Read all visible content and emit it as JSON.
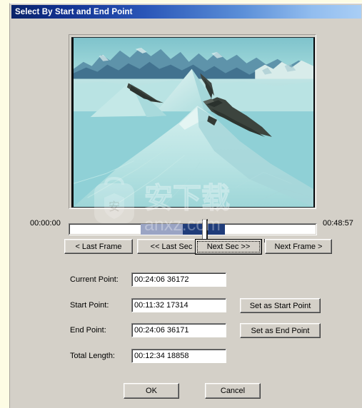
{
  "window": {
    "title": "Select By Start and End Point"
  },
  "preview": {
    "name": "video-preview",
    "description": "Snowy glacial mountain landscape video frame"
  },
  "timeline": {
    "start_label": "00:00:00",
    "end_label": "00:48:57",
    "tick_count": 21,
    "selection_start_pct": 29,
    "selection_end_pct": 63,
    "thumb_pct": 54,
    "selection_color": "#1f3c7a",
    "selection_soft_color": "#9aa4c4"
  },
  "nav_buttons": [
    {
      "id": "last-frame",
      "label": "< Last Frame",
      "focused": false
    },
    {
      "id": "last-sec",
      "label": "<< Last Sec",
      "focused": false
    },
    {
      "id": "next-sec",
      "label": "Next Sec >>",
      "focused": true
    },
    {
      "id": "next-frame",
      "label": "Next Frame >",
      "focused": false
    }
  ],
  "fields": {
    "current": {
      "label": "Current Point:",
      "value": "00:24:06 36172"
    },
    "start": {
      "label": "Start Point:",
      "value": "00:11:32 17314",
      "button": "Set as Start Point"
    },
    "end": {
      "label": "End Point:",
      "value": "00:24:06 36171",
      "button": "Set as End Point"
    },
    "total": {
      "label": "Total Length:",
      "value": "00:12:34 18858"
    }
  },
  "dialog_buttons": {
    "ok": "OK",
    "cancel": "Cancel"
  },
  "watermark": {
    "text": "anxz.com",
    "logo_char": "安",
    "brand_chars": "安下载"
  },
  "colors": {
    "face": "#d4d0c8",
    "title_start": "#0a246a",
    "title_end": "#a9cef5",
    "page_bg": "#fdfce4"
  }
}
